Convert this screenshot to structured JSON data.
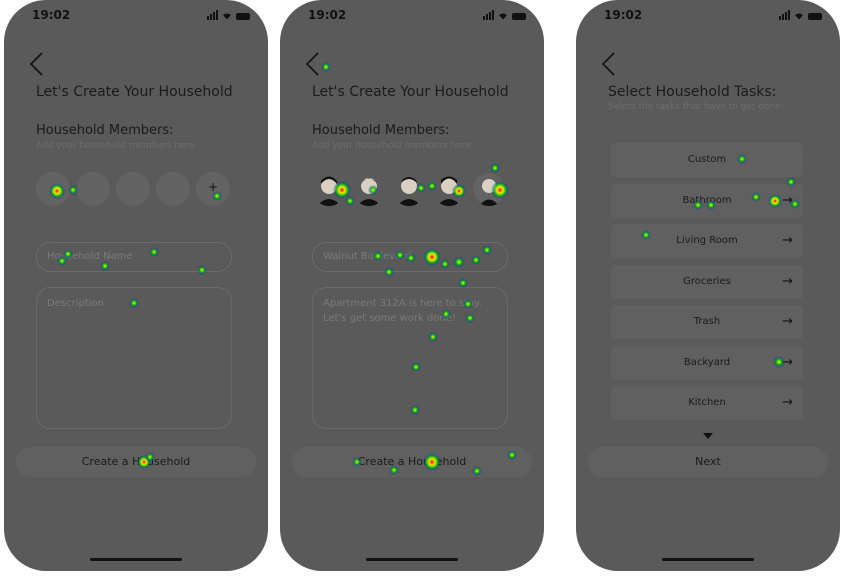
{
  "status": {
    "time": "19:02"
  },
  "create_screen": {
    "title": "Let's Create Your Household",
    "members_heading": "Household Members:",
    "members_sub": "Add your household members here",
    "add_member_glyph": "+",
    "name_placeholder": "Household Name",
    "description_placeholder": "Description",
    "create_button": "Create a Household"
  },
  "filled_screen": {
    "title": "Let's Create Your Household",
    "members_heading": "Household Members:",
    "members_sub": "Add your household members here",
    "name_value": "Walnut Boulevard",
    "description_value": "Apartment 312A is here to stay. Let's get some work done!",
    "create_button": "Create a Household"
  },
  "tasks_screen": {
    "title": "Select Household Tasks:",
    "subtitle": "Select the tasks that have to get done!",
    "tasks": [
      {
        "label": "Custom",
        "has_arrow": false
      },
      {
        "label": "Bathroom",
        "has_arrow": true
      },
      {
        "label": "Living Room",
        "has_arrow": true
      },
      {
        "label": "Groceries",
        "has_arrow": true
      },
      {
        "label": "Trash",
        "has_arrow": true
      },
      {
        "label": "Backyard",
        "has_arrow": true
      },
      {
        "label": "Kitchen",
        "has_arrow": true
      }
    ],
    "arrow_glyph": "→",
    "next_button": "Next"
  },
  "colors": {
    "screen_bg": "#5a5a5a",
    "control_bg": "#606060",
    "heat_hot": "#ff0000",
    "heat_mid": "#ffff00",
    "heat_cool": "#00c000"
  }
}
